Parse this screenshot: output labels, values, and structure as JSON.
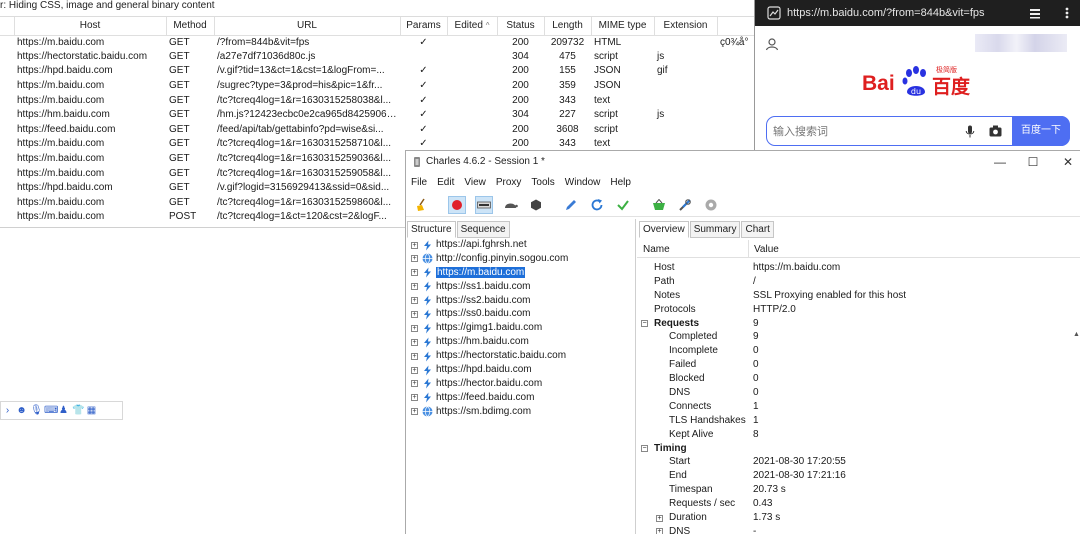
{
  "filter_bar": {
    "text": "r: Hiding CSS, image and general binary content"
  },
  "table": {
    "headers": [
      "Host",
      "Method",
      "URL",
      "Params",
      "Edited",
      "Status",
      "Length",
      "MIME type",
      "Extension"
    ],
    "edited_sort_icon": "chevron-up-icon",
    "rows": [
      {
        "host": "https://m.baidu.com",
        "method": "GET",
        "url": "/?from=844b&vit=fps",
        "params": "✓",
        "status": "200",
        "length": "209732",
        "mime": "HTML",
        "ext": "",
        "extra": "ç0¾å°"
      },
      {
        "host": "https://hectorstatic.baidu.com",
        "method": "GET",
        "url": "/a27e7df71036d80c.js",
        "params": "",
        "status": "304",
        "length": "475",
        "mime": "script",
        "ext": "js",
        "extra": ""
      },
      {
        "host": "https://hpd.baidu.com",
        "method": "GET",
        "url": "/v.gif?tid=13&ct=1&cst=1&logFrom=...",
        "params": "✓",
        "status": "200",
        "length": "155",
        "mime": "JSON",
        "ext": "gif",
        "extra": ""
      },
      {
        "host": "https://m.baidu.com",
        "method": "GET",
        "url": "/sugrec?type=3&prod=his&pic=1&fr...",
        "params": "✓",
        "status": "200",
        "length": "359",
        "mime": "JSON",
        "ext": "",
        "extra": ""
      },
      {
        "host": "https://m.baidu.com",
        "method": "GET",
        "url": "/tc?tcreq4log=1&r=1630315258038&l...",
        "params": "✓",
        "status": "200",
        "length": "343",
        "mime": "text",
        "ext": "",
        "extra": ""
      },
      {
        "host": "https://hm.baidu.com",
        "method": "GET",
        "url": "/hm.js?12423ecbc0e2ca965d84259063...",
        "params": "✓",
        "status": "304",
        "length": "227",
        "mime": "script",
        "ext": "js",
        "extra": ""
      },
      {
        "host": "https://feed.baidu.com",
        "method": "GET",
        "url": "/feed/api/tab/gettabinfo?pd=wise&si...",
        "params": "✓",
        "status": "200",
        "length": "3608",
        "mime": "script",
        "ext": "",
        "extra": ""
      },
      {
        "host": "https://m.baidu.com",
        "method": "GET",
        "url": "/tc?tcreq4log=1&r=1630315258710&l...",
        "params": "✓",
        "status": "200",
        "length": "343",
        "mime": "text",
        "ext": "",
        "extra": ""
      },
      {
        "host": "https://m.baidu.com",
        "method": "GET",
        "url": "/tc?tcreq4log=1&r=1630315259036&l...",
        "params": "",
        "status": "",
        "length": "",
        "mime": "",
        "ext": "",
        "extra": ""
      },
      {
        "host": "https://m.baidu.com",
        "method": "GET",
        "url": "/tc?tcreq4log=1&r=1630315259058&l...",
        "params": "",
        "status": "",
        "length": "",
        "mime": "",
        "ext": "",
        "extra": ""
      },
      {
        "host": "https://hpd.baidu.com",
        "method": "GET",
        "url": "/v.gif?logid=3156929413&ssid=0&sid...",
        "params": "",
        "status": "",
        "length": "",
        "mime": "",
        "ext": "",
        "extra": ""
      },
      {
        "host": "https://m.baidu.com",
        "method": "GET",
        "url": "/tc?tcreq4log=1&r=1630315259860&l...",
        "params": "",
        "status": "",
        "length": "",
        "mime": "",
        "ext": "",
        "extra": ""
      },
      {
        "host": "https://m.baidu.com",
        "method": "POST",
        "url": "/tc?tcreq4log=1&ct=120&cst=2&logF...",
        "params": "",
        "status": "",
        "length": "",
        "mime": "",
        "ext": "",
        "extra": ""
      }
    ]
  },
  "phone": {
    "url": "https://m.baidu.com/?from=844b&vit=fps",
    "logo_bai": "Bai",
    "logo_cn": "百度",
    "logo_small": "极简版",
    "search_placeholder": "输入搜索词",
    "search_button": "百度一下"
  },
  "charles": {
    "title": "Charles 4.6.2 - Session 1 *",
    "menu": [
      "File",
      "Edit",
      "View",
      "Proxy",
      "Tools",
      "Window",
      "Help"
    ],
    "left_tabs": [
      "Structure",
      "Sequence"
    ],
    "tree": [
      {
        "label": "https://api.fghrsh.net",
        "icon": "lightning-icon"
      },
      {
        "label": "http://config.pinyin.sogou.com",
        "icon": "globe-icon"
      },
      {
        "label": "https://m.baidu.com",
        "icon": "lightning-icon",
        "selected": true
      },
      {
        "label": "https://ss1.baidu.com",
        "icon": "lightning-icon"
      },
      {
        "label": "https://ss2.baidu.com",
        "icon": "lightning-icon"
      },
      {
        "label": "https://ss0.baidu.com",
        "icon": "lightning-icon"
      },
      {
        "label": "https://gimg1.baidu.com",
        "icon": "lightning-icon"
      },
      {
        "label": "https://hm.baidu.com",
        "icon": "lightning-icon"
      },
      {
        "label": "https://hectorstatic.baidu.com",
        "icon": "lightning-icon"
      },
      {
        "label": "https://hpd.baidu.com",
        "icon": "lightning-icon"
      },
      {
        "label": "https://hector.baidu.com",
        "icon": "lightning-icon"
      },
      {
        "label": "https://feed.baidu.com",
        "icon": "lightning-icon"
      },
      {
        "label": "https://sm.bdimg.com",
        "icon": "globe-icon"
      }
    ],
    "right_tabs": [
      "Overview",
      "Summary",
      "Chart"
    ],
    "overview_header": {
      "name": "Name",
      "value": "Value"
    },
    "overview": [
      {
        "name": "Host",
        "value": "https://m.baidu.com",
        "kind": "row"
      },
      {
        "name": "Path",
        "value": "/",
        "kind": "row"
      },
      {
        "name": "Notes",
        "value": "SSL Proxying enabled for this host",
        "kind": "row"
      },
      {
        "name": "Protocols",
        "value": "HTTP/2.0",
        "kind": "row"
      },
      {
        "name": "Requests",
        "value": "9",
        "kind": "grp"
      },
      {
        "name": "Completed",
        "value": "9",
        "kind": "sub"
      },
      {
        "name": "Incomplete",
        "value": "0",
        "kind": "sub"
      },
      {
        "name": "Failed",
        "value": "0",
        "kind": "sub"
      },
      {
        "name": "Blocked",
        "value": "0",
        "kind": "sub"
      },
      {
        "name": "DNS",
        "value": "0",
        "kind": "sub"
      },
      {
        "name": "Connects",
        "value": "1",
        "kind": "sub"
      },
      {
        "name": "TLS Handshakes",
        "value": "1",
        "kind": "sub"
      },
      {
        "name": "Kept Alive",
        "value": "8",
        "kind": "sub"
      },
      {
        "name": "Timing",
        "value": "",
        "kind": "grp"
      },
      {
        "name": "Start",
        "value": "2021-08-30 17:20:55",
        "kind": "sub"
      },
      {
        "name": "End",
        "value": "2021-08-30 17:21:16",
        "kind": "sub"
      },
      {
        "name": "Timespan",
        "value": "20.73 s",
        "kind": "sub"
      },
      {
        "name": "Requests / sec",
        "value": "0.43",
        "kind": "sub"
      },
      {
        "name": "Duration",
        "value": "1.73 s",
        "kind": "subexp"
      },
      {
        "name": "DNS",
        "value": "-",
        "kind": "subexp"
      }
    ]
  },
  "colors": {
    "selection": "#1e6fd9",
    "baidu_red": "#de1f1f",
    "baidu_blue": "#4e6ef2"
  }
}
